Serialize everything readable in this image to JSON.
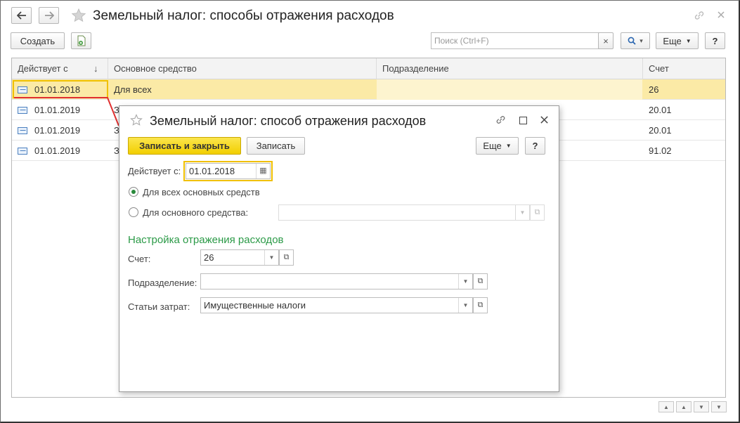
{
  "window": {
    "title": "Земельный налог: способы отражения расходов"
  },
  "toolbar": {
    "create_label": "Создать",
    "search_placeholder": "Поиск (Ctrl+F)",
    "clear_label": "×",
    "search_dropdown": "▾",
    "more_label": "Еще",
    "help_label": "?"
  },
  "table": {
    "columns": [
      "Действует с",
      "Основное средство",
      "Подразделение",
      "Счет"
    ],
    "sort_indicator": "↓",
    "rows": [
      {
        "date": "01.01.2018",
        "asset": "Для всех",
        "division": "",
        "account": "26"
      },
      {
        "date": "01.01.2019",
        "asset": "З",
        "division": "",
        "account": "20.01"
      },
      {
        "date": "01.01.2019",
        "asset": "З",
        "division": "",
        "account": "20.01"
      },
      {
        "date": "01.01.2019",
        "asset": "З",
        "division": "",
        "account": "91.02"
      }
    ]
  },
  "dialog": {
    "title": "Земельный налог: способ отражения расходов",
    "save_close_label": "Записать и закрыть",
    "save_label": "Записать",
    "more_label": "Еще",
    "help_label": "?",
    "valid_from_label": "Действует с:",
    "valid_from_value": "01.01.2018",
    "radio_all_label": "Для всех основных средств",
    "radio_one_label": "Для основного средства:",
    "radio_selected": "all",
    "asset_value": "",
    "section_title": "Настройка отражения расходов",
    "account_label": "Счет:",
    "account_value": "26",
    "division_label": "Подразделение:",
    "division_value": "",
    "cost_item_label": "Статьи затрат:",
    "cost_item_value": "Имущественные налоги"
  },
  "colors": {
    "primary_button": "#f5d800",
    "highlight_border": "#f0c000",
    "selected_row": "#fbeaa6",
    "section_title": "#2b9a47",
    "annotation_line": "#e03030"
  }
}
